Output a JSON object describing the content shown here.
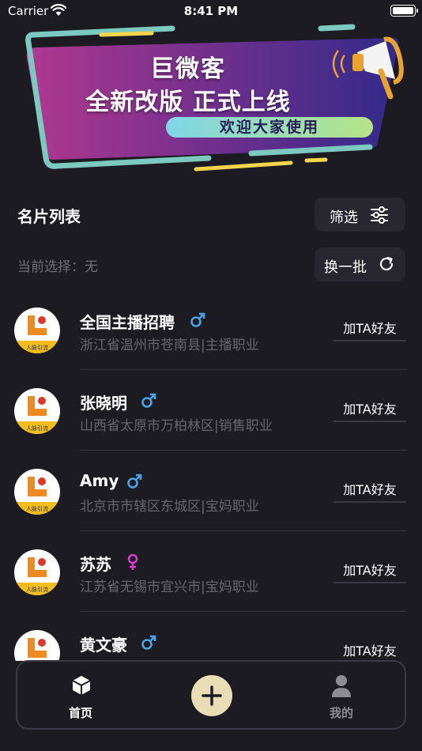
{
  "status_bar": {
    "carrier": "Carrier",
    "time": "8:41 PM"
  },
  "banner": {
    "title": "巨微客",
    "subtitle": "全新改版  正式上线",
    "tagline": "欢迎大家使用"
  },
  "header": {
    "section_title": "名片列表",
    "filter_label": "筛选",
    "selection_label": "当前选择：无",
    "refresh_label": "换一批"
  },
  "avatar_caption": "人脉引流",
  "cards": [
    {
      "name": "全国主播招聘",
      "gender": "male",
      "location": "浙江省温州市苍南县|主播职业",
      "action": "加TA好友"
    },
    {
      "name": "张晓明",
      "gender": "male",
      "location": "山西省太原市万柏林区|销售职业",
      "action": "加TA好友"
    },
    {
      "name": "Amy",
      "gender": "male",
      "location": "北京市市辖区东城区|宝妈职业",
      "action": "加TA好友"
    },
    {
      "name": "苏苏",
      "gender": "female",
      "location": "江苏省无锡市宜兴市|宝妈职业",
      "action": "加TA好友"
    },
    {
      "name": "黄文豪",
      "gender": "male",
      "location": "",
      "action": "加TA好友"
    }
  ],
  "tab_bar": {
    "home_label": "首页",
    "me_label": "我的"
  },
  "colors": {
    "male": "#4aa3e6",
    "female": "#d63ad0",
    "background": "#1c1b22"
  }
}
